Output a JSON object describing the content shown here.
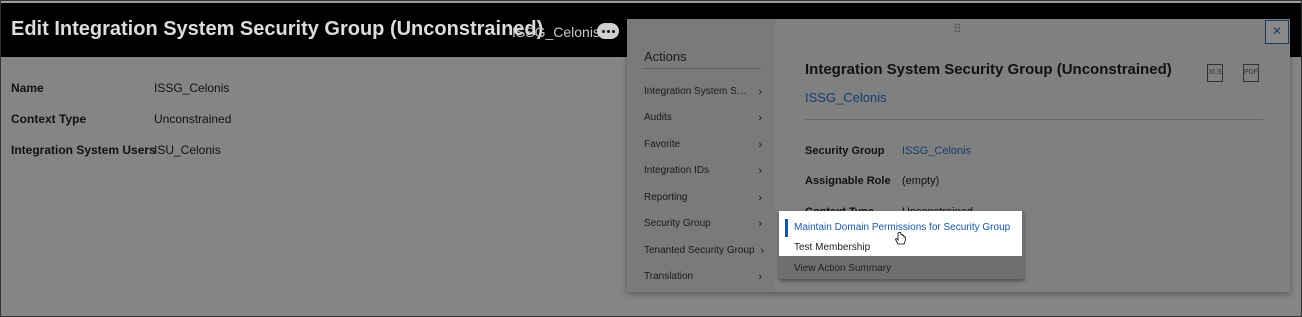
{
  "header": {
    "title": "Edit Integration System Security Group (Unconstrained)",
    "subtitle": "ISSG_Celonis"
  },
  "fields": [
    {
      "label": "Name",
      "value": "ISSG_Celonis"
    },
    {
      "label": "Context Type",
      "value": "Unconstrained"
    },
    {
      "label": "Integration System Users",
      "value": "ISU_Celonis"
    }
  ],
  "actions": {
    "heading": "Actions",
    "items": [
      {
        "label": "Integration System Sec..."
      },
      {
        "label": "Audits"
      },
      {
        "label": "Favorite"
      },
      {
        "label": "Integration IDs"
      },
      {
        "label": "Reporting"
      },
      {
        "label": "Security Group"
      },
      {
        "label": "Tenanted Security Group"
      },
      {
        "label": "Translation"
      }
    ]
  },
  "detail": {
    "title": "Integration System Security Group (Unconstrained)",
    "link": "ISSG_Celonis",
    "rows": [
      {
        "label": "Security Group",
        "value": "ISSG_Celonis"
      },
      {
        "label": "Assignable Role",
        "value": "(empty)"
      },
      {
        "label": "Context Type",
        "value": "Unconstrained"
      }
    ],
    "excel_icon": "excel-export-icon",
    "pdf_icon": "pdf-export-icon"
  },
  "submenu": {
    "items": [
      {
        "label": "Maintain Domain Permissions for Security Group"
      },
      {
        "label": "Test Membership"
      },
      {
        "label": "View Action Summary"
      }
    ]
  },
  "icons": {
    "close": "×",
    "chevron": "›",
    "grip": "⠿"
  },
  "colors": {
    "link": "#1457a6",
    "header_bg": "#000000"
  }
}
